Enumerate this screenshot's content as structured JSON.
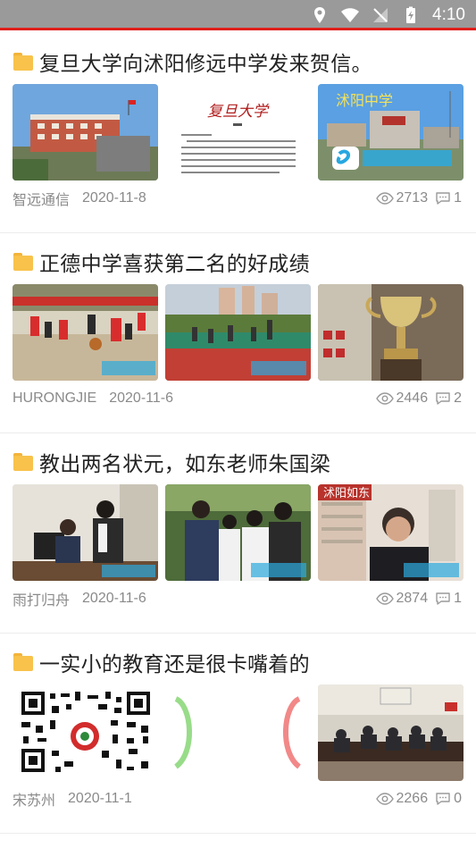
{
  "status_bar": {
    "time": "4:10"
  },
  "posts": [
    {
      "title": "复旦大学向沭阳修远中学发来贺信。",
      "author": "智远通信",
      "date": "2020-11-8",
      "views": "2713",
      "comments": "1",
      "thumb_texts": [
        "",
        "复旦大学",
        "沭阳中学"
      ]
    },
    {
      "title": "正德中学喜获第二名的好成绩",
      "author": "HURONGJIE",
      "date": "2020-11-6",
      "views": "2446",
      "comments": "2",
      "thumb_texts": [
        "",
        "",
        ""
      ]
    },
    {
      "title": "教出两名状元，如东老师朱国梁",
      "author": "雨打归舟",
      "date": "2020-11-6",
      "views": "2874",
      "comments": "1",
      "thumb_texts": [
        "",
        "",
        "沭阳如东"
      ]
    },
    {
      "title": "一实小的教育还是很卡嘴着的",
      "author": "宋苏州",
      "date": "2020-11-1",
      "views": "2266",
      "comments": "0",
      "thumb_texts": [
        "",
        "",
        ""
      ]
    }
  ]
}
